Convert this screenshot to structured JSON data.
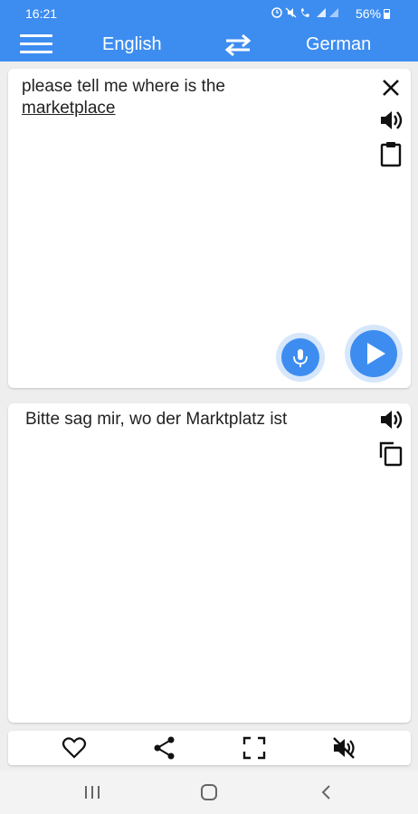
{
  "status_bar": {
    "time": "16:21",
    "icons": [
      "alarm-icon",
      "mute-icon",
      "wifi-call-icon",
      "signal-icon"
    ],
    "battery": "56%"
  },
  "header": {
    "menu_icon": "hamburger-menu-icon",
    "source_language": "English",
    "swap_icon": "swap-icon",
    "target_language": "German",
    "accent_color": "#3d8df0"
  },
  "input": {
    "line1": "please tell me where is the",
    "line2": "marketplace",
    "clear_icon": "close-icon",
    "speak_icon": "speaker-icon",
    "paste_icon": "clipboard-icon",
    "mic_icon": "mic-icon",
    "translate_icon": "play-icon"
  },
  "output": {
    "text": "Bitte sag mir, wo der Marktplatz ist",
    "speak_icon": "speaker-icon",
    "copy_icon": "copy-icon"
  },
  "toolbar": {
    "items": [
      "heart-icon",
      "share-icon",
      "fullscreen-icon",
      "mute-speaker-icon"
    ]
  },
  "system_nav": {
    "items": [
      "recents-icon",
      "home-icon",
      "back-icon"
    ]
  }
}
